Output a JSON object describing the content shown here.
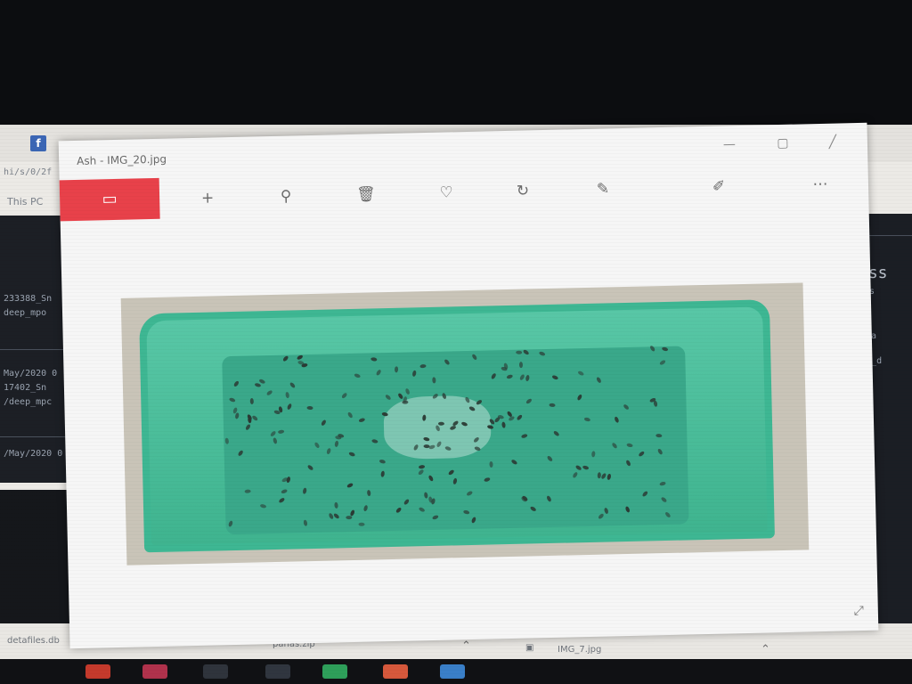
{
  "photos_app": {
    "window_title": "Ash - IMG_20.jpg",
    "toolbar": [
      {
        "name": "view-image",
        "glyph": "▭",
        "active": true
      },
      {
        "name": "add",
        "glyph": "+"
      },
      {
        "name": "zoom",
        "glyph": "⚲"
      },
      {
        "name": "delete",
        "glyph": "🗑"
      },
      {
        "name": "favorite",
        "glyph": "♡"
      },
      {
        "name": "rotate",
        "glyph": "↻"
      },
      {
        "name": "crop",
        "glyph": "✎"
      },
      {
        "name": "edit",
        "glyph": "✐"
      },
      {
        "name": "more",
        "glyph": "⋯"
      }
    ],
    "accent_color": "#e8414a"
  },
  "browser": {
    "url_fragment": "hi/s/0/2f",
    "tab_text": "This PC"
  },
  "terminal_left": {
    "lines": [
      "233388_Sn",
      "deep_mpo",
      "May/2020 0",
      "17402_Sn",
      "/deep_mpc",
      "",
      "/May/2020 0"
    ]
  },
  "terminal_right": {
    "lines": [
      "ass",
      "ss",
      "d_Ma",
      "ses_d",
      "m"
    ]
  },
  "downloads_bar": {
    "item1": "detafiles.db",
    "item2": "panas.zip",
    "item3": "IMG_7.jpg"
  }
}
